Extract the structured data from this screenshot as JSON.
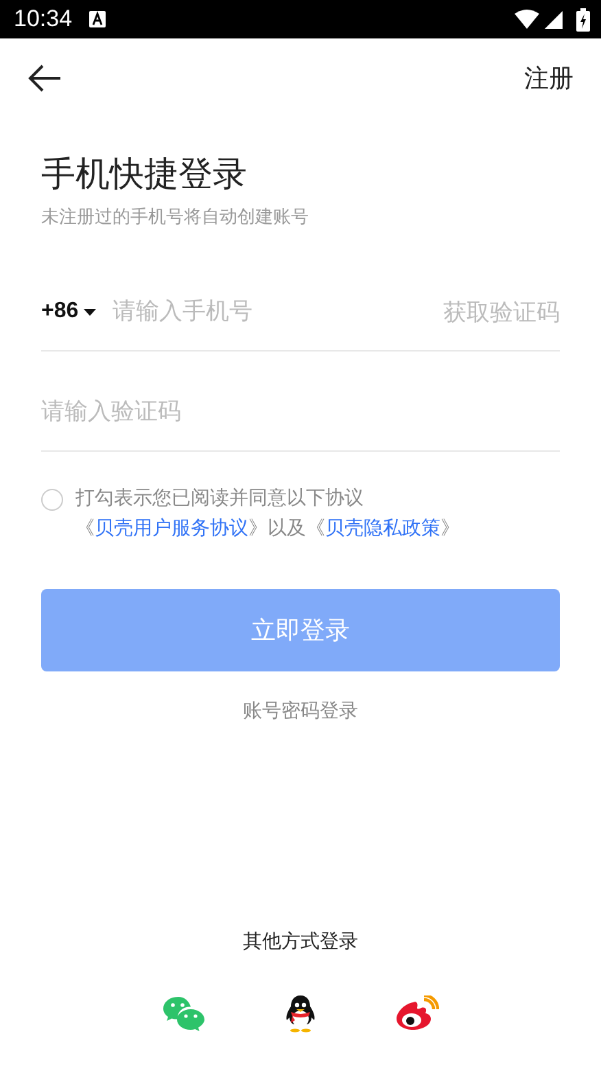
{
  "status_bar": {
    "time": "10:34"
  },
  "nav": {
    "action": "注册"
  },
  "title": "手机快捷登录",
  "subtitle": "未注册过的手机号将自动创建账号",
  "phone": {
    "country_code": "+86",
    "placeholder": "请输入手机号",
    "code_button": "获取验证码"
  },
  "code_field": {
    "placeholder": "请输入验证码"
  },
  "agreement": {
    "checked": false,
    "parts": [
      {
        "kind": "plain",
        "text": "打勾表示您已阅读并同意以下协议《"
      },
      {
        "kind": "link",
        "text": "贝壳用户服务协议"
      },
      {
        "kind": "plain",
        "text": "》以及《"
      },
      {
        "kind": "link",
        "text": "贝壳隐私政策"
      },
      {
        "kind": "plain",
        "text": "》"
      }
    ]
  },
  "login_button": {
    "label": "立即登录",
    "disabled": true
  },
  "password_login": "账号密码登录",
  "other_login": {
    "title": "其他方式登录",
    "methods": [
      {
        "kind": "wechat"
      },
      {
        "kind": "qq"
      },
      {
        "kind": "weibo"
      }
    ]
  }
}
